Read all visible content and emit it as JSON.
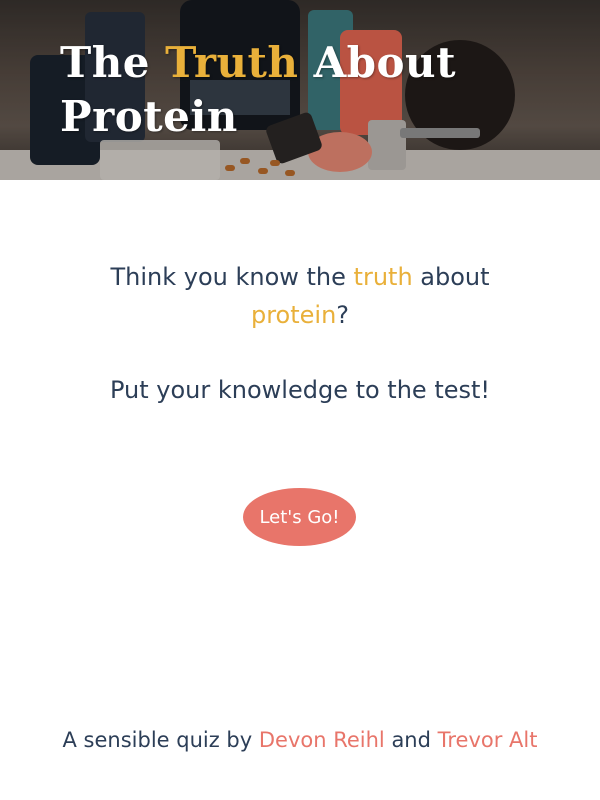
{
  "hero": {
    "title_part1": "The ",
    "title_accent": "Truth",
    "title_part2": " About Protein"
  },
  "intro": {
    "line1_a": "Think you know the ",
    "line1_accent1": "truth",
    "line1_b": " about ",
    "line1_accent2": "protein",
    "line1_c": "?",
    "tagline": "Put your knowledge to the test!"
  },
  "cta": {
    "label": "Let's Go!"
  },
  "footer": {
    "prefix": "A sensible quiz by ",
    "author1": "Devon Reihl",
    "and": " and ",
    "author2": "Trevor Alt"
  },
  "colors": {
    "accent_gold": "#e9b03a",
    "accent_coral": "#e8756a",
    "text_navy": "#2c3e57"
  }
}
